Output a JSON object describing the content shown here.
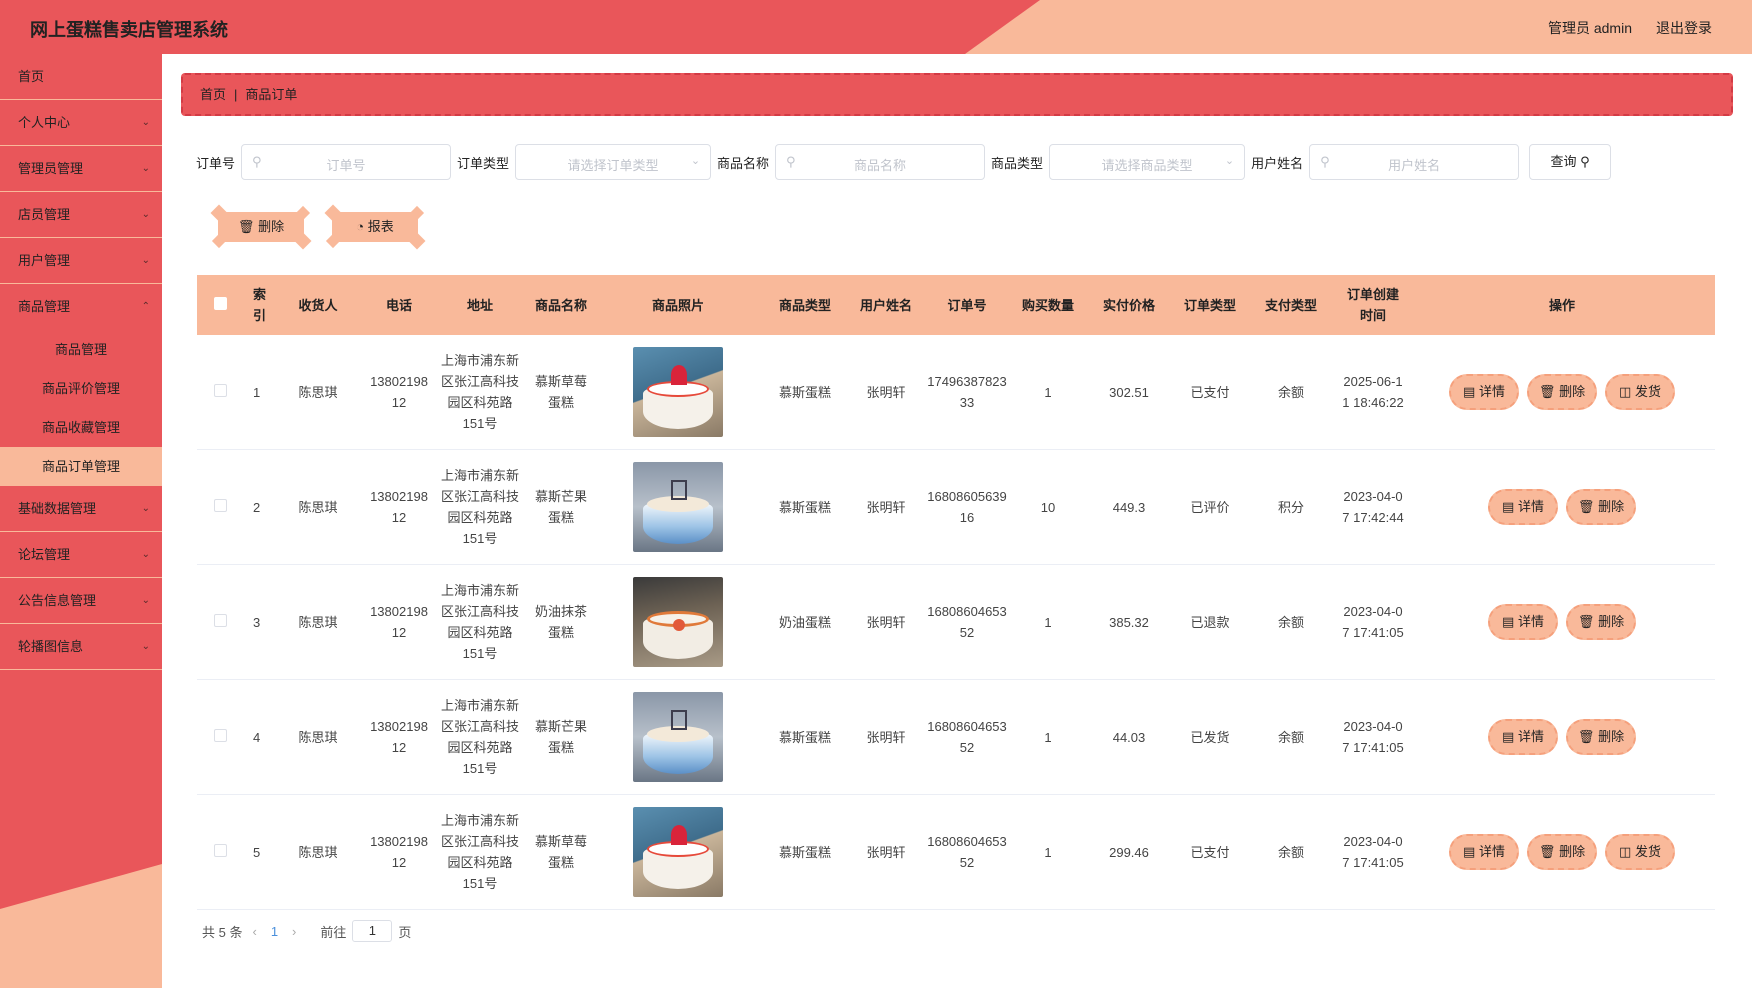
{
  "header": {
    "title": "网上蛋糕售卖店管理系统",
    "user_label": "管理员 admin",
    "logout_label": "退出登录"
  },
  "sidebar": {
    "items": [
      {
        "label": "首页"
      },
      {
        "label": "个人中心"
      },
      {
        "label": "管理员管理"
      },
      {
        "label": "店员管理"
      },
      {
        "label": "用户管理"
      },
      {
        "label": "商品管理"
      }
    ],
    "subitems": [
      {
        "label": "商品管理"
      },
      {
        "label": "商品评价管理"
      },
      {
        "label": "商品收藏管理"
      },
      {
        "label": "商品订单管理"
      }
    ],
    "items_after": [
      {
        "label": "基础数据管理"
      },
      {
        "label": "论坛管理"
      },
      {
        "label": "公告信息管理"
      },
      {
        "label": "轮播图信息"
      }
    ]
  },
  "breadcrumb": {
    "home": "首页",
    "separator": "|",
    "current": "商品订单"
  },
  "search": {
    "order_no_label": "订单号",
    "order_no_placeholder": "订单号",
    "order_type_label": "订单类型",
    "order_type_placeholder": "请选择订单类型",
    "product_name_label": "商品名称",
    "product_name_placeholder": "商品名称",
    "product_type_label": "商品类型",
    "product_type_placeholder": "请选择商品类型",
    "user_name_label": "用户姓名",
    "user_name_placeholder": "用户姓名",
    "query_label": "查询"
  },
  "actions": {
    "delete_label": "删除",
    "report_label": "报表"
  },
  "table": {
    "headers": {
      "index": "索引",
      "receiver": "收货人",
      "phone": "电话",
      "address": "地址",
      "product_name": "商品名称",
      "product_photo": "商品照片",
      "product_type": "商品类型",
      "user_name": "用户姓名",
      "order_no": "订单号",
      "quantity": "购买数量",
      "price": "实付价格",
      "order_type": "订单类型",
      "pay_type": "支付类型",
      "created_time": "订单创建时间",
      "operations": "操作"
    },
    "op_labels": {
      "detail": "详情",
      "delete": "删除",
      "ship": "发货"
    },
    "rows": [
      {
        "index": "1",
        "receiver": "陈思琪",
        "phone": "1380219812",
        "address": "上海市浦东新区张江高科技园区科苑路151号",
        "product_name": "慕斯草莓蛋糕",
        "product_type": "慕斯蛋糕",
        "user_name": "张明轩",
        "order_no": "1749638782333",
        "quantity": "1",
        "price": "302.51",
        "order_type": "已支付",
        "pay_type": "余额",
        "created_time": "2025-06-11 18:46:22",
        "photo": "cake-strawberry-photo"
      },
      {
        "index": "2",
        "receiver": "陈思琪",
        "phone": "1380219812",
        "address": "上海市浦东新区张江高科技园区科苑路151号",
        "product_name": "慕斯芒果蛋糕",
        "product_type": "慕斯蛋糕",
        "user_name": "张明轩",
        "order_no": "1680860563916",
        "quantity": "10",
        "price": "449.3",
        "order_type": "已评价",
        "pay_type": "积分",
        "created_time": "2023-04-07 17:42:44",
        "photo": "cake-mango-photo"
      },
      {
        "index": "3",
        "receiver": "陈思琪",
        "phone": "1380219812",
        "address": "上海市浦东新区张江高科技园区科苑路151号",
        "product_name": "奶油抹茶蛋糕",
        "product_type": "奶油蛋糕",
        "user_name": "张明轩",
        "order_no": "1680860465352",
        "quantity": "1",
        "price": "385.32",
        "order_type": "已退款",
        "pay_type": "余额",
        "created_time": "2023-04-07 17:41:05",
        "photo": "cake-matcha-photo"
      },
      {
        "index": "4",
        "receiver": "陈思琪",
        "phone": "1380219812",
        "address": "上海市浦东新区张江高科技园区科苑路151号",
        "product_name": "慕斯芒果蛋糕",
        "product_type": "慕斯蛋糕",
        "user_name": "张明轩",
        "order_no": "1680860465352",
        "quantity": "1",
        "price": "44.03",
        "order_type": "已发货",
        "pay_type": "余额",
        "created_time": "2023-04-07 17:41:05",
        "photo": "cake-mango-photo"
      },
      {
        "index": "5",
        "receiver": "陈思琪",
        "phone": "1380219812",
        "address": "上海市浦东新区张江高科技园区科苑路151号",
        "product_name": "慕斯草莓蛋糕",
        "product_type": "慕斯蛋糕",
        "user_name": "张明轩",
        "order_no": "1680860465352",
        "quantity": "1",
        "price": "299.46",
        "order_type": "已支付",
        "pay_type": "余额",
        "created_time": "2023-04-07 17:41:05",
        "photo": "cake-strawberry-photo"
      }
    ]
  },
  "pagination": {
    "total_text": "共 5 条",
    "current_page": "1",
    "goto_prefix": "前往",
    "goto_value": "1",
    "goto_suffix": "页"
  },
  "colors": {
    "primary_red": "#e9565a",
    "peach": "#f9b99a",
    "link_blue": "#4a8fdb"
  }
}
